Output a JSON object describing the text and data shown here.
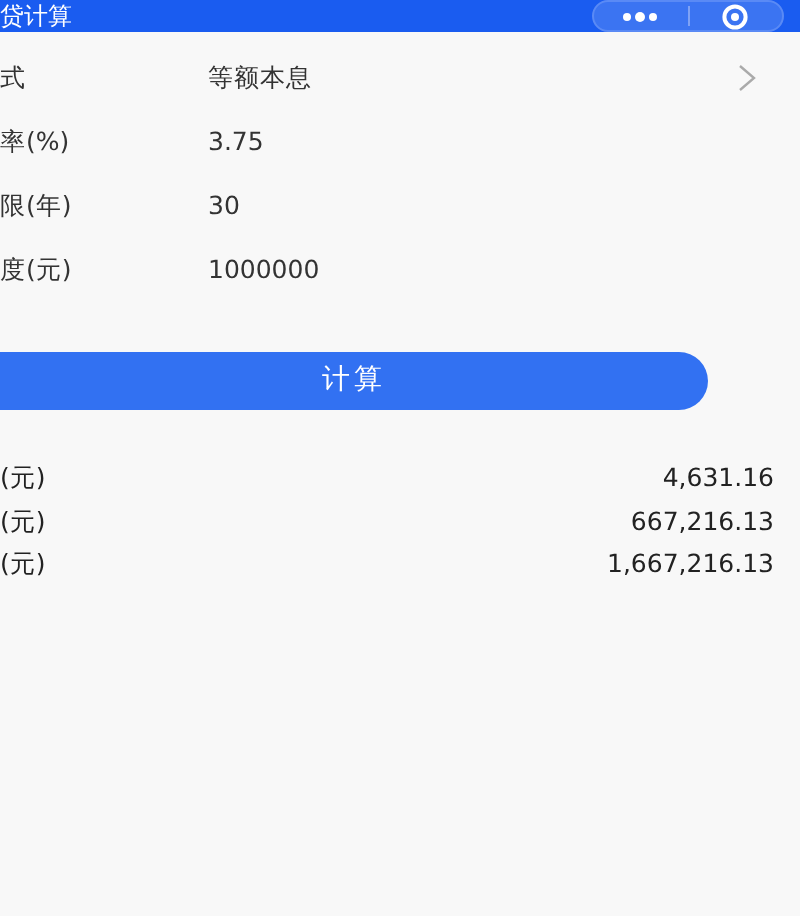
{
  "window": {
    "title": "贷计算"
  },
  "form": [
    {
      "label": "式",
      "value": "等额本息",
      "kind": "picker"
    },
    {
      "label": "率(%)",
      "value": "3.75",
      "kind": "input"
    },
    {
      "label": "限(年)",
      "value": "30",
      "kind": "input"
    },
    {
      "label": "度(元)",
      "value": "1000000",
      "kind": "input"
    }
  ],
  "button": "计算",
  "results": [
    {
      "label": "(元)",
      "value": "4,631.16"
    },
    {
      "label": "(元)",
      "value": "667,216.13"
    },
    {
      "label": "(元)",
      "value": "1,667,216.13"
    }
  ]
}
